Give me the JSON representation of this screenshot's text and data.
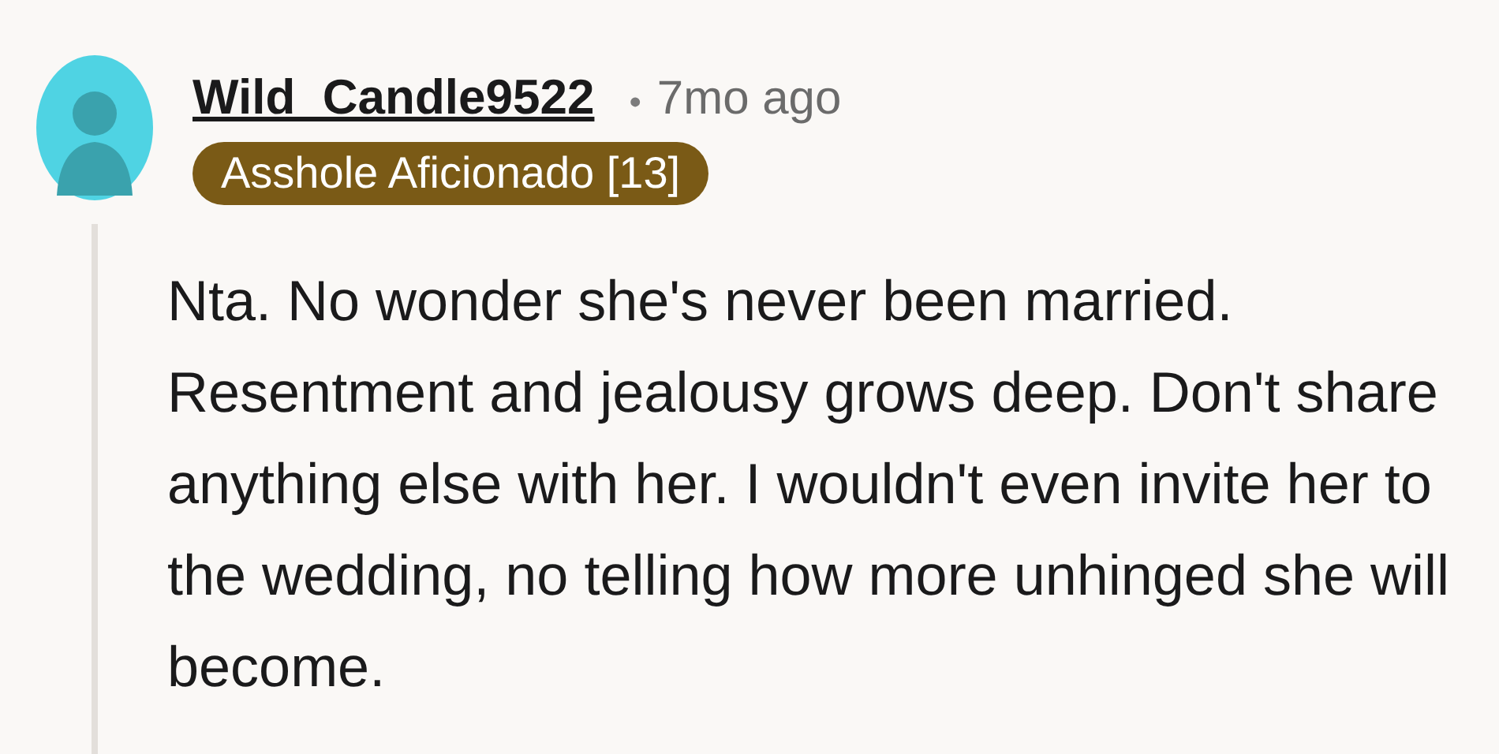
{
  "comment": {
    "author": "Wild_Candle9522",
    "separator": "•",
    "age": "7mo ago",
    "flair": {
      "text": "Asshole Aficionado [13]",
      "color": "#7a5a16"
    },
    "body": "Nta. No wonder she's never been married. Resentment and jealousy grows deep. Don't share anything else with her. I wouldn't even invite her to the wedding, no telling how more unhinged she will become."
  }
}
